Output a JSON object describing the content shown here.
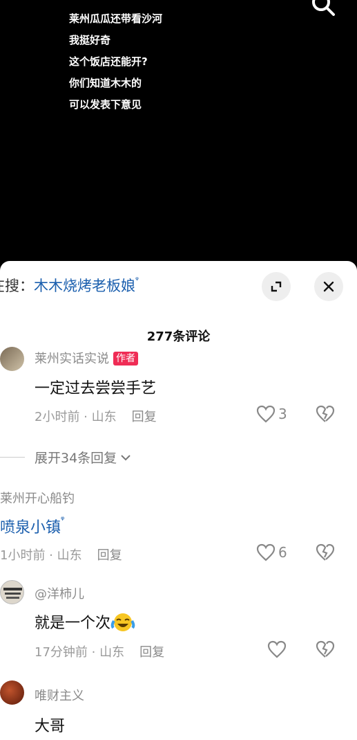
{
  "video": {
    "caption_lines": [
      "莱州瓜瓜还带看沙河",
      "我挺好奇",
      "这个饭店还能开?",
      "你们知道木木的",
      "可以发表下意见"
    ]
  },
  "sheet": {
    "hot_search_prefix": "在搜：",
    "hot_search_term": "木木烧烤老板娘",
    "comment_count": "277条评论"
  },
  "comments": [
    {
      "name": "莱州实话实说",
      "badge": "作者",
      "text": "一定过去尝尝手艺",
      "meta": "2小时前 · 山东",
      "reply": "回复",
      "likes": "3",
      "expand": "展开34条回复"
    },
    {
      "name": "莱州开心船钓",
      "text": "喷泉小镇",
      "meta": "1小时前 · 山东",
      "reply": "回复",
      "likes": "6"
    },
    {
      "name": "@洋柿儿",
      "text": "就是一个次",
      "meta": "17分钟前 · 山东",
      "reply": "回复",
      "likes": ""
    },
    {
      "name": "唯财主义",
      "text": "大哥"
    }
  ],
  "colors": {
    "accent_link": "#1b5fae",
    "badge": "#ef2c55"
  }
}
